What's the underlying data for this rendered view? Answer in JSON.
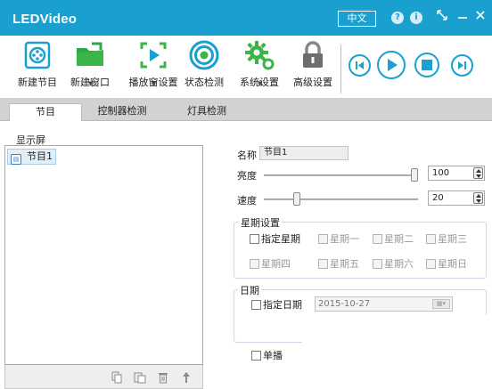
{
  "window": {
    "title": "LEDVideo",
    "language_button": "中文",
    "help_glyph": "?",
    "info_glyph": "i"
  },
  "toolbar": {
    "items": [
      {
        "label": "新建节目",
        "icon": "film-reel-icon"
      },
      {
        "label": "新建窗口",
        "icon": "folder-icon"
      },
      {
        "label": "播放窗设置",
        "icon": "frame-play-icon"
      },
      {
        "label": "状态检测",
        "icon": "target-icon"
      },
      {
        "label": "系统设置",
        "icon": "gear-icon"
      },
      {
        "label": "高级设置",
        "icon": "lock-icon"
      }
    ],
    "playback": [
      "previous-icon",
      "play-icon",
      "stop-icon",
      "next-icon"
    ]
  },
  "tabs": [
    {
      "label": "节目",
      "active": true
    },
    {
      "label": "控制器检测",
      "active": false
    },
    {
      "label": "灯具检测",
      "active": false
    }
  ],
  "left_panel": {
    "header": "显示屏",
    "items": [
      {
        "label": "节目1"
      }
    ]
  },
  "properties": {
    "name_label": "名称",
    "name_value": "节目1",
    "brightness_label": "亮度",
    "brightness_value": "100",
    "brightness_level": 1.0,
    "speed_label": "速度",
    "speed_value": "20",
    "speed_level": 0.2,
    "week_group": {
      "title": "星期设置",
      "specify_label": "指定星期",
      "days": [
        "星期一",
        "星期二",
        "星期三",
        "星期四",
        "星期五",
        "星期六",
        "星期日"
      ]
    },
    "date_group": {
      "title": "日期",
      "specify_label": "指定日期",
      "date_value": "2015-10-27"
    },
    "single_play_label": "单播"
  },
  "colors": {
    "title_bar": "#1aa0cf",
    "accent": "#1aa0cf",
    "icon_green": "#3bb54a"
  }
}
